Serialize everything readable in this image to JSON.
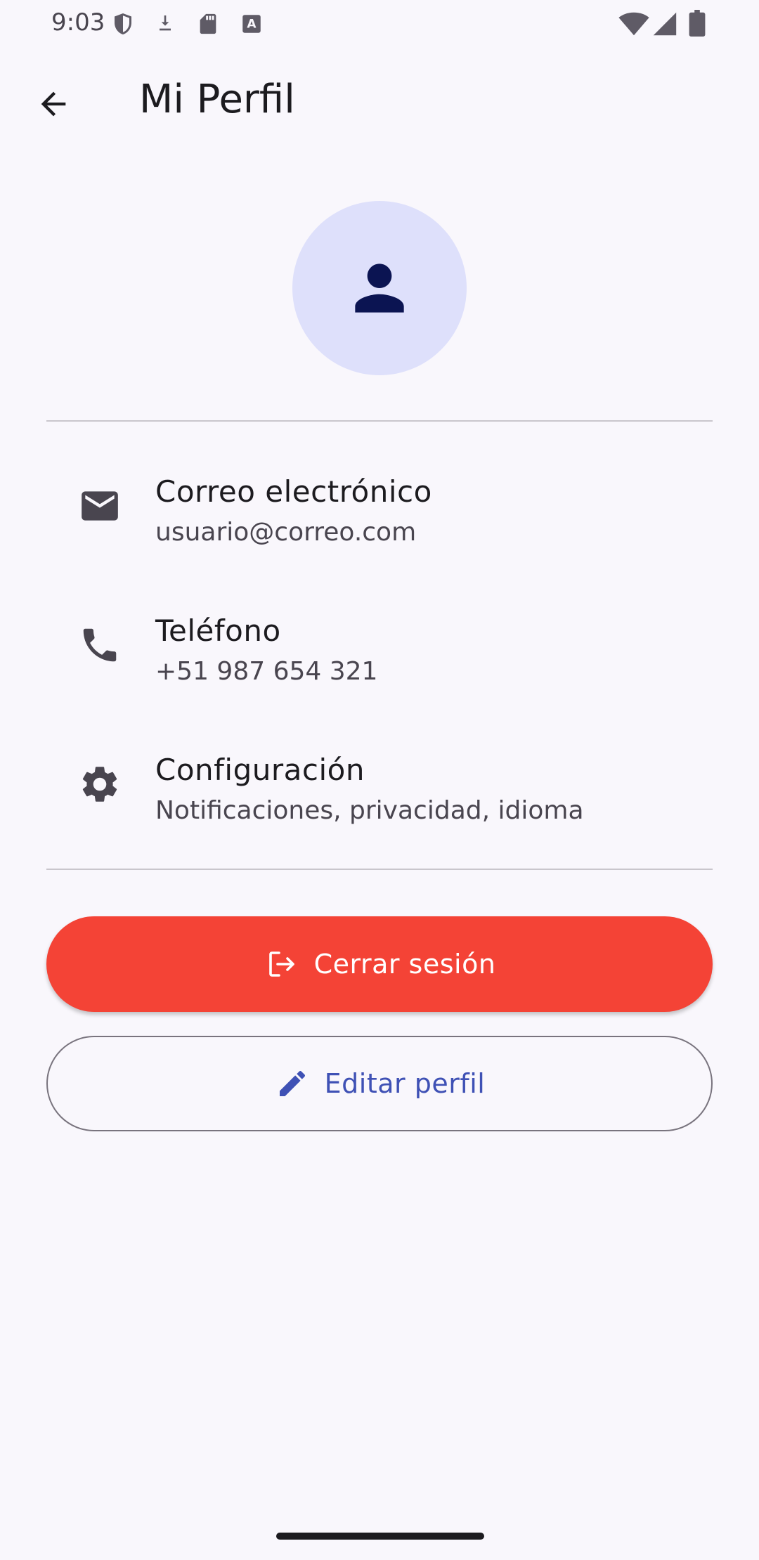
{
  "status_bar": {
    "time": "9:03",
    "left_icons": [
      "shield-icon",
      "download-icon",
      "sd-card-icon",
      "keyboard-a-icon"
    ],
    "right_icons": [
      "wifi-icon",
      "cell-signal-icon",
      "battery-icon"
    ]
  },
  "app_bar": {
    "back_icon": "arrow-back-icon",
    "title": "Mi Perfil"
  },
  "avatar": {
    "icon": "person-icon",
    "background": "#dee0fb",
    "icon_color": "#0b1452"
  },
  "profile_items": [
    {
      "icon": "email-icon",
      "title": "Correo electrónico",
      "subtitle": "usuario@correo.com"
    },
    {
      "icon": "phone-icon",
      "title": "Teléfono",
      "subtitle": "+51 987 654 321"
    },
    {
      "icon": "settings-icon",
      "title": "Configuración",
      "subtitle": "Notificaciones, privacidad, idioma"
    }
  ],
  "actions": {
    "logout": {
      "label": "Cerrar sesión",
      "icon": "logout-icon",
      "color": "#f44336"
    },
    "edit": {
      "label": "Editar perfil",
      "icon": "pencil-icon",
      "color": "#3f51b5"
    }
  }
}
